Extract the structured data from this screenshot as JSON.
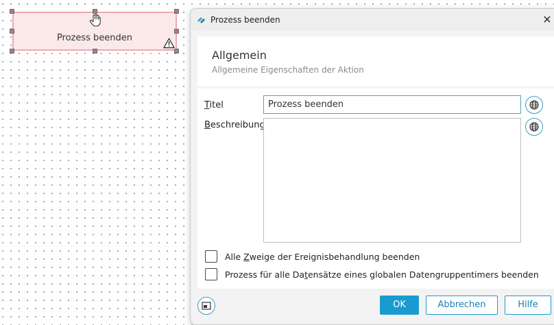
{
  "canvas": {
    "node_label": "Prozess beenden"
  },
  "dialog": {
    "window_title": "Prozess beenden",
    "close_glyph": "✕",
    "header": {
      "title": "Allgemein",
      "subtitle": "Allgemeine Eigenschaften der Aktion"
    },
    "form": {
      "title_label_first": "T",
      "title_label_rest": "itel",
      "title_value": "Prozess beenden",
      "description_label_first": "B",
      "description_label_rest": "eschreibung",
      "description_value": ""
    },
    "checkboxes": [
      {
        "label_pre": "Alle ",
        "label_accel": "Z",
        "label_post": "weige der Ereignisbehandlung beenden",
        "checked": false
      },
      {
        "label_pre": "Prozess für alle Da",
        "label_accel": "t",
        "label_post": "ensätze eines globalen Datengruppentimers beenden",
        "checked": false
      }
    ],
    "buttons": {
      "ok": "OK",
      "cancel": "Abbrechen",
      "help": "Hilfe"
    }
  },
  "icons": {
    "app": "app-logo-icon",
    "hand": "hand-cursor-icon",
    "warning": "warning-icon",
    "globe": "globe-icon",
    "layout": "window-layout-icon"
  },
  "colors": {
    "accent": "#1a9bd0",
    "node_fill": "#fbe9ea",
    "node_border": "#f0a7ad"
  }
}
